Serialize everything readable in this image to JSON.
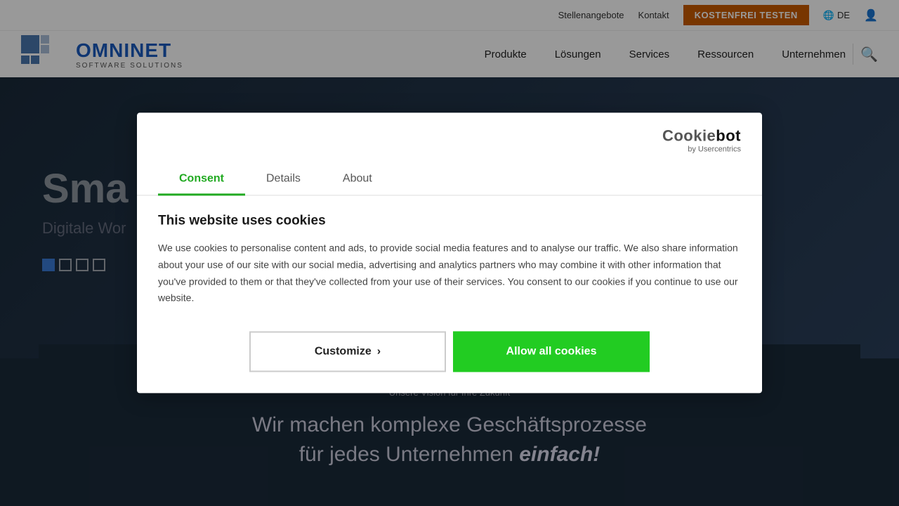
{
  "header": {
    "nav_links": [
      "Stellenangebote",
      "Kontakt"
    ],
    "cta_label": "KOSTENFREI TESTEN",
    "lang_label": "DE",
    "logo_omni": "OMNI",
    "logo_net": "NET",
    "logo_sub": "SOFTWARE SOLUTIONS",
    "nav_items": [
      "Produkte",
      "Lösungen",
      "Services",
      "Ressourcen",
      "Unternehmen"
    ]
  },
  "hero": {
    "headline": "Sma",
    "subtext": "Digitale Wor",
    "dots": [
      "active",
      "inactive",
      "inactive",
      "inactive"
    ]
  },
  "bottom": {
    "vision_label": "Unsere Vision für Ihre Zukunft",
    "headline_line1": "Wir machen komplexe Geschäftsprozesse",
    "headline_line2": "für jedes Unternehmen",
    "headline_emphasis": "einfach!"
  },
  "cookie_modal": {
    "brand_name": "Cookiebot",
    "brand_sub": "by Usercentrics",
    "tabs": [
      "Consent",
      "Details",
      "About"
    ],
    "active_tab": "Consent",
    "title": "This website uses cookies",
    "body_text": "We use cookies to personalise content and ads, to provide social media features and to analyse our traffic. We also share information about your use of our site with our social media, advertising and analytics partners who may combine it with other information that you've provided to them or that they've collected from your use of their services. You consent to our cookies if you continue to use our website.",
    "btn_customize": "Customize",
    "btn_allow": "Allow all cookies"
  },
  "colors": {
    "accent_green": "#22cc22",
    "accent_orange": "#c85a00",
    "accent_blue": "#1a5bbf",
    "dark_bg": "#1a2a3a"
  }
}
